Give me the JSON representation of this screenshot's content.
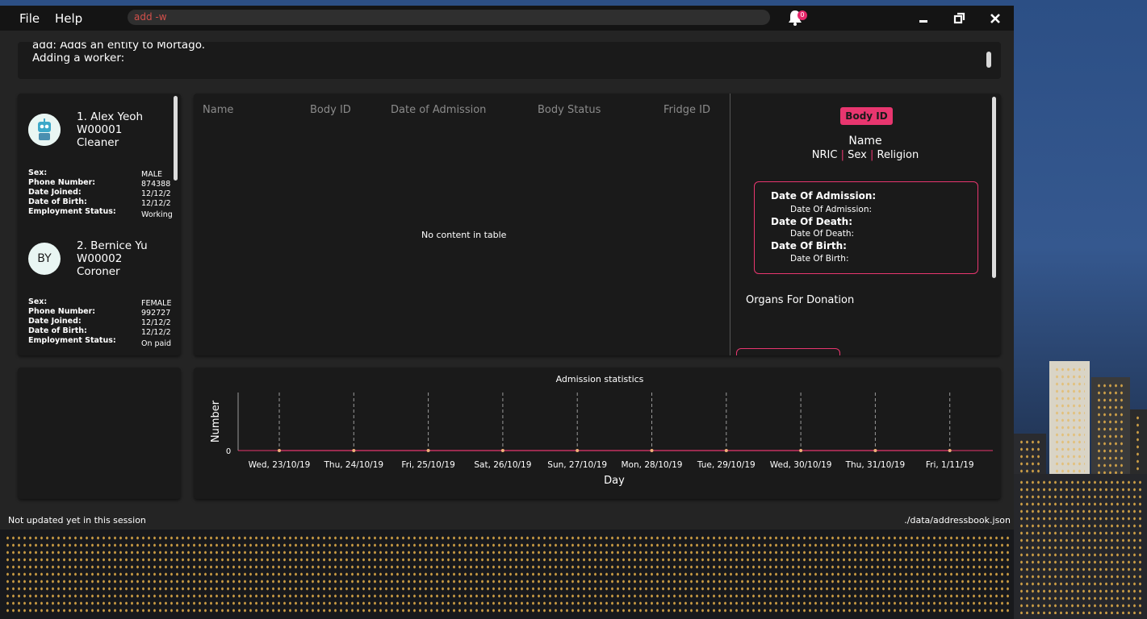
{
  "menu": {
    "file": "File",
    "help": "Help"
  },
  "command_box": {
    "value": "add -w"
  },
  "notifications": {
    "count": "0"
  },
  "result_display": {
    "text": "add: Adds an entity to Mortago.\nAdding a worker:"
  },
  "workers": [
    {
      "index_name": "1. Alex Yeoh",
      "id": "W00001",
      "designation": "Cleaner",
      "avatar": "robot-avatar-icon",
      "fields": [
        {
          "label": "Sex:",
          "value": "MALE"
        },
        {
          "label": "Phone Number:",
          "value": "874388"
        },
        {
          "label": "Date Joined:",
          "value": "12/12/2"
        },
        {
          "label": "Date of Birth:",
          "value": "12/12/2"
        },
        {
          "label": "Employment Status:",
          "value": "Working"
        }
      ]
    },
    {
      "index_name": "2. Bernice Yu",
      "id": "W00002",
      "designation": "Coroner",
      "avatar_initials": "BY",
      "fields": [
        {
          "label": "Sex:",
          "value": "FEMALE"
        },
        {
          "label": "Phone Number:",
          "value": "992727"
        },
        {
          "label": "Date Joined:",
          "value": "12/12/2"
        },
        {
          "label": "Date of Birth:",
          "value": "12/12/2"
        },
        {
          "label": "Employment Status:",
          "value": "On paid"
        }
      ]
    }
  ],
  "table": {
    "headers": [
      "Name",
      "Body ID",
      "Date of Admission",
      "Body Status",
      "Fridge ID"
    ],
    "placeholder": "No content in table"
  },
  "details": {
    "badge": "Body ID",
    "name": "Name",
    "nric": "NRIC",
    "sex": "Sex",
    "religion": "Religion",
    "separator": "|",
    "dates": [
      {
        "label": "Date Of Admission:",
        "value": "Date Of Admission:"
      },
      {
        "label": "Date Of Death:",
        "value": "Date Of Death:"
      },
      {
        "label": "Date Of Birth:",
        "value": "Date Of Birth:"
      }
    ],
    "organs": "Organs For Donation"
  },
  "chart_data": {
    "type": "line",
    "title": "Admission statistics",
    "xlabel": "Day",
    "ylabel": "Number",
    "categories": [
      "Wed, 23/10/19",
      "Thu, 24/10/19",
      "Fri, 25/10/19",
      "Sat, 26/10/19",
      "Sun, 27/10/19",
      "Mon, 28/10/19",
      "Tue, 29/10/19",
      "Wed, 30/10/19",
      "Thu, 31/10/19",
      "Fri, 1/11/19"
    ],
    "series": [
      {
        "values": [
          0,
          0,
          0,
          0,
          0,
          0,
          0,
          0,
          0,
          0
        ]
      }
    ],
    "y_ticks": [
      "0"
    ],
    "ylim": [
      0,
      1
    ],
    "colors": {
      "line": "#e8366f",
      "point": "#f0b27a",
      "grid": "#9a9a9a"
    },
    "grid": "vertical-dashed"
  },
  "status_bar": {
    "left": "Not updated yet in this session",
    "right": "./data/addressbook.json"
  }
}
